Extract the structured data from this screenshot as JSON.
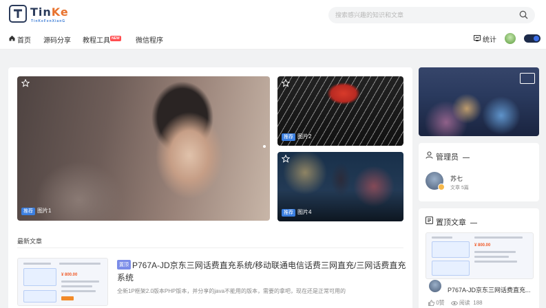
{
  "header": {
    "logo_text_main": "Tin",
    "logo_text_accent": "Ke",
    "logo_subtitle": "TinKeFenXianG",
    "search_placeholder": "搜索感兴趣的知识和文章"
  },
  "nav": {
    "items": [
      {
        "label": "首页",
        "icon": "home-icon"
      },
      {
        "label": "源码分享"
      },
      {
        "label": "教程工具",
        "badge": "NEW"
      },
      {
        "label": "微信程序"
      }
    ],
    "stats_label": "统计",
    "theme_toggle": "on"
  },
  "carousel": {
    "main": {
      "tag": "推荐",
      "label": "图片1"
    },
    "side_top": {
      "tag": "推荐",
      "label": "图片2"
    },
    "side_bottom": {
      "tag": "推荐",
      "label": "图片4"
    }
  },
  "latest": {
    "section_title": "最新文章",
    "article": {
      "badge": "置顶",
      "title": "P767A-JD京东三网话费直充系统/移动联通电信话费三网直充/三网话费直充系统",
      "desc": "全新1P框架2.0版本PHP版本，并分享的java不能用的版本，需要的拿吧，现在还是正常可用的",
      "thumb_price": "¥ 800.00"
    }
  },
  "sidebar": {
    "admin": {
      "heading": "管理员",
      "name": "苏七",
      "meta": "文章 5篇"
    },
    "top_articles": {
      "heading": "置顶文章",
      "title": "P767A-JD京东三网话费直充...",
      "thumb_price": "¥ 800.00",
      "likes": "0赞",
      "views_label": "阅读",
      "views": "188"
    }
  },
  "colors": {
    "accent": "#3b7fe0",
    "badge_new": "#ff4d4f",
    "pin_badge": "#7b8ce8",
    "logo_navy": "#2a3a5a",
    "logo_orange": "#e8732f"
  }
}
